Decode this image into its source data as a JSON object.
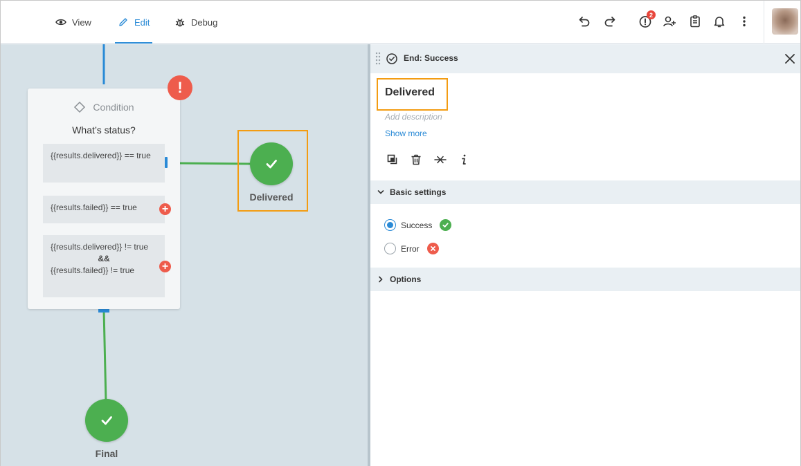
{
  "toolbar": {
    "tabs": [
      {
        "label": "View",
        "icon": "eye-icon"
      },
      {
        "label": "Edit",
        "icon": "pencil-icon",
        "active": true
      },
      {
        "label": "Debug",
        "icon": "bug-icon"
      }
    ],
    "actions": {
      "undo": "undo-icon",
      "redo": "redo-icon",
      "alerts_badge": "2",
      "add_user": "add-user-icon",
      "clipboard": "clipboard-icon",
      "notifications": "bell-icon",
      "more": "more-icon"
    },
    "accent_color": "#2a8ad6"
  },
  "canvas": {
    "condition_node": {
      "type_label": "Condition",
      "title": "What’s status?",
      "conditions": [
        {
          "text": "{{results.delivered}} == true"
        },
        {
          "text": "{{results.failed}} == true"
        },
        {
          "line1": "{{results.delivered}}  != true",
          "operator": "&&",
          "line2": "{{results.failed}}  != true"
        }
      ],
      "alert_symbol": "!"
    },
    "end_nodes": [
      {
        "label": "Delivered",
        "color": "#4caf50"
      },
      {
        "label": "Final",
        "color": "#4caf50"
      }
    ]
  },
  "panel": {
    "header_title": "End: Success",
    "name": "Delivered",
    "description_placeholder": "Add description",
    "show_more": "Show more",
    "sections": {
      "basic_settings": "Basic settings",
      "options": "Options"
    },
    "statuses": [
      {
        "label": "Success",
        "selected": true,
        "color": "#4caf50"
      },
      {
        "label": "Error",
        "selected": false,
        "color": "#ee5c4c"
      }
    ],
    "highlight_color": "#f39c12"
  }
}
